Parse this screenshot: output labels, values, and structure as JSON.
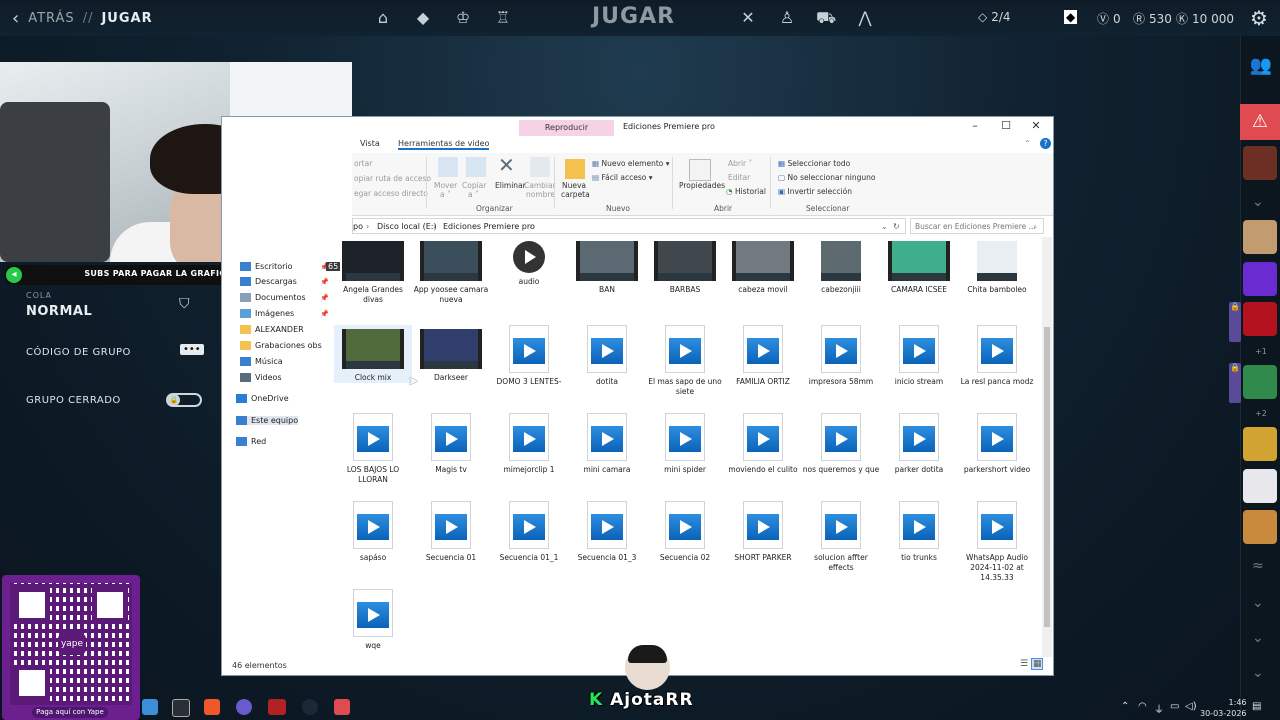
{
  "game": {
    "back_label": "ATRÁS",
    "separator": "//",
    "section_label": "JUGAR",
    "play_title": "JUGAR",
    "party_count": "2/4",
    "vp": "0",
    "rp": "530",
    "kp": "10 000",
    "left_panel": {
      "queue_label": "COLA",
      "queue_value": "NORMAL",
      "group_code": "CÓDIGO DE GRUPO",
      "closed_group": "GRUPO CERRADO"
    },
    "social": {
      "plus_one": "+1",
      "plus_two": "+2"
    }
  },
  "overlay": {
    "sub_text": "SUBS PARA PAGAR LA GRAFICA",
    "sub_count": "65",
    "qr_pill": "Paga aquí con Yape",
    "yape_label": "yape",
    "streamer_logo_k": "K",
    "streamer_logo": "AjotaRR"
  },
  "explorer": {
    "context_tab": "Reproducir",
    "window_title": "Ediciones Premiere pro",
    "tabs": [
      "Vista",
      "Herramientas de video"
    ],
    "ribbon": {
      "clipboard": [
        "ortar",
        "opiar ruta de acceso",
        "egar acceso directo"
      ],
      "organize": {
        "mover": "Mover",
        "mover2": "a ˅",
        "copiar": "Copiar",
        "copiar2": "a ˅",
        "eliminar": "Eliminar",
        "cambiar": "Cambiar",
        "nombre": "nombre",
        "group": "Organizar"
      },
      "new": {
        "nuevo_elemento": "Nuevo elemento ▾",
        "facil_acceso": "Fácil acceso ▾",
        "nueva": "Nueva",
        "carpeta": "carpeta",
        "group": "Nuevo"
      },
      "open": {
        "propiedades": "Propiedades",
        "abrir": "Abrir ˅",
        "editar": "Editar",
        "historial": "Historial",
        "group": "Abrir"
      },
      "select": {
        "all": "Seleccionar todo",
        "none": "No seleccionar ninguno",
        "invert": "Invertir selección",
        "group": "Seleccionar"
      }
    },
    "address": {
      "prefix": "po",
      "drive": "Disco local (E:)",
      "folder": "Ediciones Premiere pro",
      "search_placeholder": "Buscar en Ediciones Premiere ..."
    },
    "nav": [
      {
        "label": "Escritorio",
        "pinned": true
      },
      {
        "label": "Descargas",
        "pinned": true
      },
      {
        "label": "Documentos",
        "pinned": true
      },
      {
        "label": "Imágenes",
        "pinned": true
      },
      {
        "label": "ALEXANDER",
        "pinned": false
      },
      {
        "label": "Grabaciones obs",
        "pinned": false
      },
      {
        "label": "Música",
        "pinned": false
      },
      {
        "label": "Videos",
        "pinned": false
      },
      {
        "label": "OneDrive",
        "pinned": false
      },
      {
        "label": "Este equipo",
        "pinned": false
      },
      {
        "label": "Red",
        "pinned": false
      }
    ],
    "files": [
      {
        "name": "Angela Grandes divas",
        "kind": "video"
      },
      {
        "name": "App yoosee camara nueva",
        "kind": "video"
      },
      {
        "name": "audio",
        "kind": "audio"
      },
      {
        "name": "BAN",
        "kind": "video"
      },
      {
        "name": "BARBAS",
        "kind": "video"
      },
      {
        "name": "cabeza movil",
        "kind": "video"
      },
      {
        "name": "cabezonjiii",
        "kind": "video"
      },
      {
        "name": "CAMARA ICSEE",
        "kind": "video"
      },
      {
        "name": "Chita bamboleo",
        "kind": "video"
      },
      {
        "name": "Clock mix",
        "kind": "video"
      },
      {
        "name": "Darkseer",
        "kind": "video"
      },
      {
        "name": "DOMO  3 LENTES-",
        "kind": "doc"
      },
      {
        "name": "dotita",
        "kind": "doc"
      },
      {
        "name": "El mas sapo de uno siete",
        "kind": "doc"
      },
      {
        "name": "FAMILIA ORTIZ",
        "kind": "doc"
      },
      {
        "name": "impresora 58mm",
        "kind": "doc"
      },
      {
        "name": "inicio stream",
        "kind": "doc"
      },
      {
        "name": "La resl panca modz",
        "kind": "doc"
      },
      {
        "name": "LOS BAJOS LO LLORAN",
        "kind": "doc"
      },
      {
        "name": "Magis tv",
        "kind": "doc"
      },
      {
        "name": "mimejorclip 1",
        "kind": "doc"
      },
      {
        "name": "mini camara",
        "kind": "doc"
      },
      {
        "name": "mini spider",
        "kind": "doc"
      },
      {
        "name": "moviendo el culito",
        "kind": "doc"
      },
      {
        "name": "nos queremos y que",
        "kind": "doc"
      },
      {
        "name": "parker dotita",
        "kind": "doc"
      },
      {
        "name": "parkershort video",
        "kind": "doc"
      },
      {
        "name": "sapáso",
        "kind": "doc"
      },
      {
        "name": "Secuencia 01",
        "kind": "doc"
      },
      {
        "name": "Secuencia 01_1",
        "kind": "doc"
      },
      {
        "name": "Secuencia 01_3",
        "kind": "doc"
      },
      {
        "name": "Secuencia 02",
        "kind": "doc"
      },
      {
        "name": "SHORT PARKER",
        "kind": "doc"
      },
      {
        "name": "solucion affter effects",
        "kind": "doc"
      },
      {
        "name": "tio trunks",
        "kind": "doc"
      },
      {
        "name": "WhatsApp Audio 2024-11-02 at 14.35.33",
        "kind": "doc"
      },
      {
        "name": "wqe",
        "kind": "doc"
      }
    ],
    "status": "46 elementos"
  },
  "taskbar": {
    "time": "1:46",
    "date": "30-03-2026"
  },
  "colors": {
    "accent_red": "#e04b52",
    "yape_purple": "#6c1f8e",
    "explorer_blue": "#1a73c8"
  }
}
